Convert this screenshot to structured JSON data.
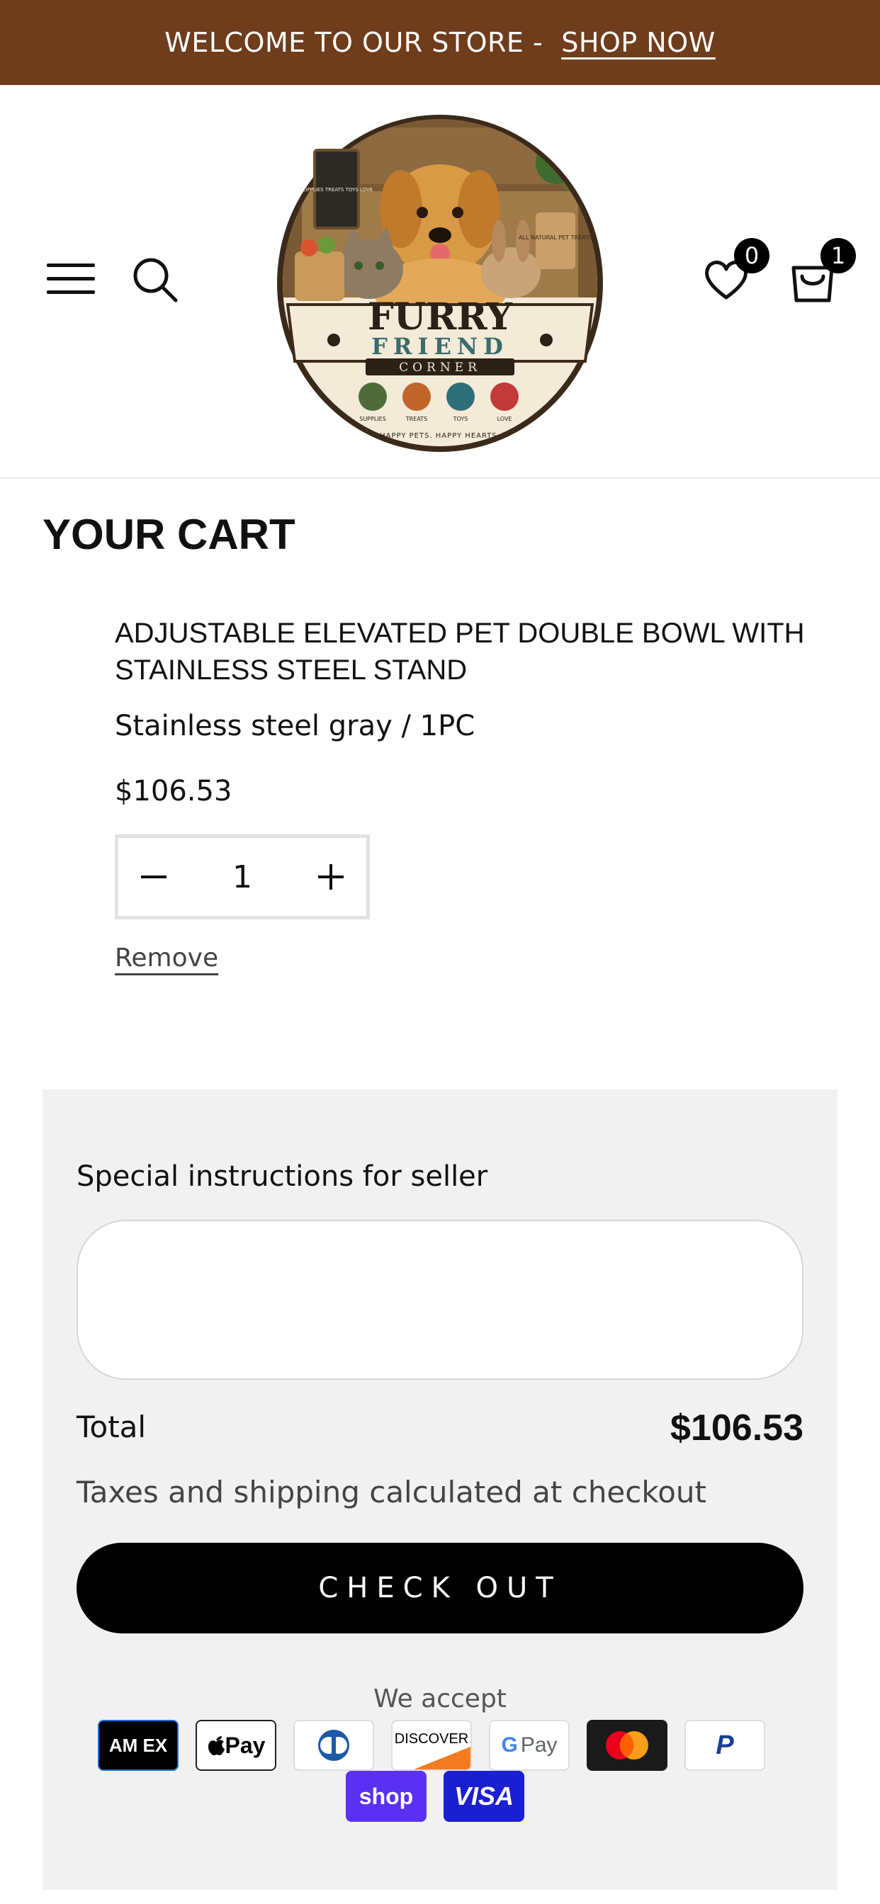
{
  "announcement": {
    "text": "WELCOME TO OUR STORE -",
    "link": "SHOP NOW"
  },
  "header": {
    "wishlist_count": "0",
    "cart_count": "1",
    "logo": {
      "brand_line1": "FURRY",
      "brand_line2": "FRIEND",
      "brand_line3": "CORNER",
      "sign_text": "SUPPLIES TREATS TOYS LOVE",
      "bag_text": "ALL NATURAL PET TREATS",
      "badges": [
        "SUPPLIES",
        "TREATS",
        "TOYS",
        "LOVE"
      ],
      "tagline": "HAPPY PETS. HAPPY HEARTS."
    }
  },
  "cart": {
    "title": "YOUR CART",
    "item": {
      "title": "ADJUSTABLE ELEVATED PET DOUBLE BOWL WITH STAINLESS STEEL STAND",
      "variant": "Stainless steel gray / 1PC",
      "price": "$106.53",
      "quantity": "1",
      "remove_label": "Remove"
    }
  },
  "summary": {
    "instructions_label": "Special instructions for seller",
    "instructions_value": "",
    "total_label": "Total",
    "total_value": "$106.53",
    "tax_note": "Taxes and shipping calculated at checkout",
    "checkout_label": "CHECK OUT",
    "accept_label": "We accept",
    "payment_methods": [
      {
        "name": "amex-icon",
        "label": "AM EX",
        "bg": "#000000",
        "fg": "#ffffff"
      },
      {
        "name": "apple-pay-icon",
        "label": "Pay",
        "bg": "#ffffff",
        "fg": "#000000"
      },
      {
        "name": "diners-club-icon",
        "label": "",
        "bg": "#ffffff",
        "fg": "#1a5aa8"
      },
      {
        "name": "discover-icon",
        "label": "DISCOVER",
        "bg": "#ffffff",
        "fg": "#000000"
      },
      {
        "name": "google-pay-icon",
        "label": "Pay",
        "bg": "#ffffff",
        "fg": "#5f6368"
      },
      {
        "name": "mastercard-icon",
        "label": "",
        "bg": "#1a1a1a",
        "fg": "#ffffff"
      },
      {
        "name": "paypal-icon",
        "label": "P",
        "bg": "#ffffff",
        "fg": "#1b3f94"
      },
      {
        "name": "shop-pay-icon",
        "label": "shop",
        "bg": "#5a31f4",
        "fg": "#ffffff"
      },
      {
        "name": "visa-icon",
        "label": "VISA",
        "bg": "#1a1fcf",
        "fg": "#ffffff"
      }
    ]
  },
  "colors": {
    "announcement_bg": "#6f3c1c",
    "accent": "#000000",
    "summary_bg": "#f1f1f1"
  }
}
